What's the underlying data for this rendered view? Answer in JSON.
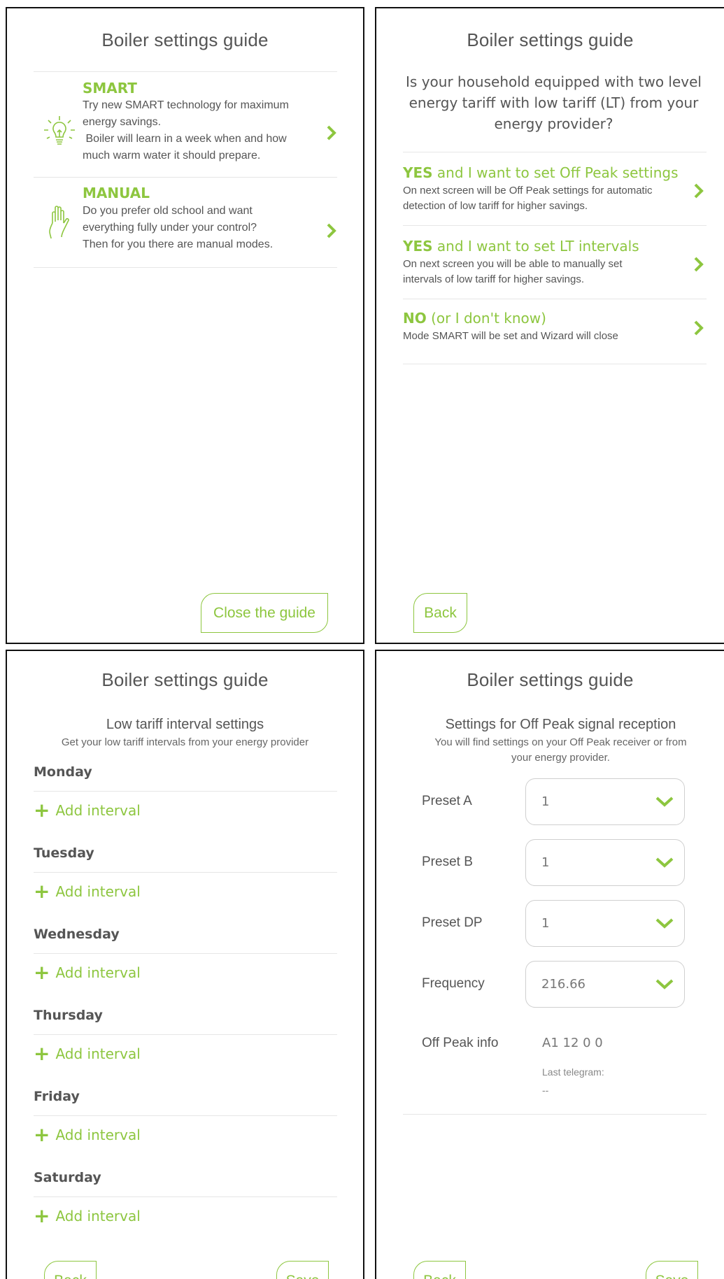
{
  "common": {
    "title": "Boiler settings guide",
    "back_label": "Back",
    "save_label": "Save",
    "accent_color": "#8dc63f"
  },
  "screen1": {
    "smart": {
      "title": "SMART",
      "desc_lines": [
        "Try new SMART technology for maximum",
        "energy savings.",
        " Boiler will learn in a week when and how",
        "much warm water it should prepare."
      ],
      "icon": "lightbulb-icon"
    },
    "manual": {
      "title": "MANUAL",
      "desc_lines": [
        "Do you prefer old school and want",
        "everything fully under your control?",
        "Then for you there are manual modes."
      ],
      "icon": "hand-icon"
    },
    "close_label": "Close the guide"
  },
  "screen2": {
    "question_lines": [
      "Is your household equipped with two level",
      "energy tariff with low tariff (LT) from your",
      "energy provider?"
    ],
    "answers": [
      {
        "strong": "YES",
        "rest": " and I want to set Off Peak settings",
        "desc_lines": [
          "On next screen will be Off Peak settings for automatic",
          "detection of low tariff for higher savings."
        ]
      },
      {
        "strong": "YES",
        "rest": " and I want to set LT intervals",
        "desc_lines": [
          "On next screen you will be able to manually set",
          "intervals of low tariff for higher savings."
        ]
      },
      {
        "strong": "NO",
        "rest": " (or I don't know)",
        "desc_lines": [
          "Mode SMART will be set and Wizard will close"
        ]
      }
    ]
  },
  "screen3": {
    "subtitle": "Low tariff interval settings",
    "subdesc": "Get your low tariff intervals from your energy provider",
    "add_interval_label": "Add interval",
    "days": [
      "Monday",
      "Tuesday",
      "Wednesday",
      "Thursday",
      "Friday",
      "Saturday"
    ]
  },
  "screen4": {
    "subtitle": "Settings for Off Peak signal reception",
    "subdesc_lines": [
      "You will find settings on your Off Peak receiver or from",
      "your energy provider."
    ],
    "fields": [
      {
        "label": "Preset A",
        "value": "1"
      },
      {
        "label": "Preset B",
        "value": "1"
      },
      {
        "label": "Preset DP",
        "value": "1"
      },
      {
        "label": "Frequency",
        "value": "216.66"
      }
    ],
    "info": {
      "label": "Off Peak info",
      "value": "A1 12 0 0",
      "last_telegram_label": "Last telegram:",
      "last_telegram_value": "--"
    }
  }
}
